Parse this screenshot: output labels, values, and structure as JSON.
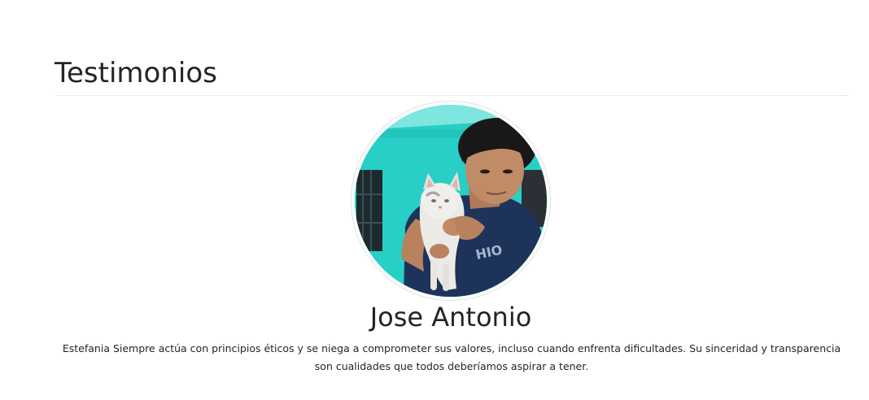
{
  "section": {
    "title": "Testimonios"
  },
  "testimonial": {
    "name": "Jose Antonio",
    "text": "Estefania Siempre actúa con principios éticos y se niega a comprometer sus valores, incluso cuando enfrenta dificultades. Su sinceridad y transparencia son cualidades que todos deberíamos aspirar a tener.",
    "avatar_icon": "avatar-photo"
  },
  "colors": {
    "text": "#212529",
    "divider": "#e9ecef",
    "avatar_border": "#dee2e6"
  }
}
